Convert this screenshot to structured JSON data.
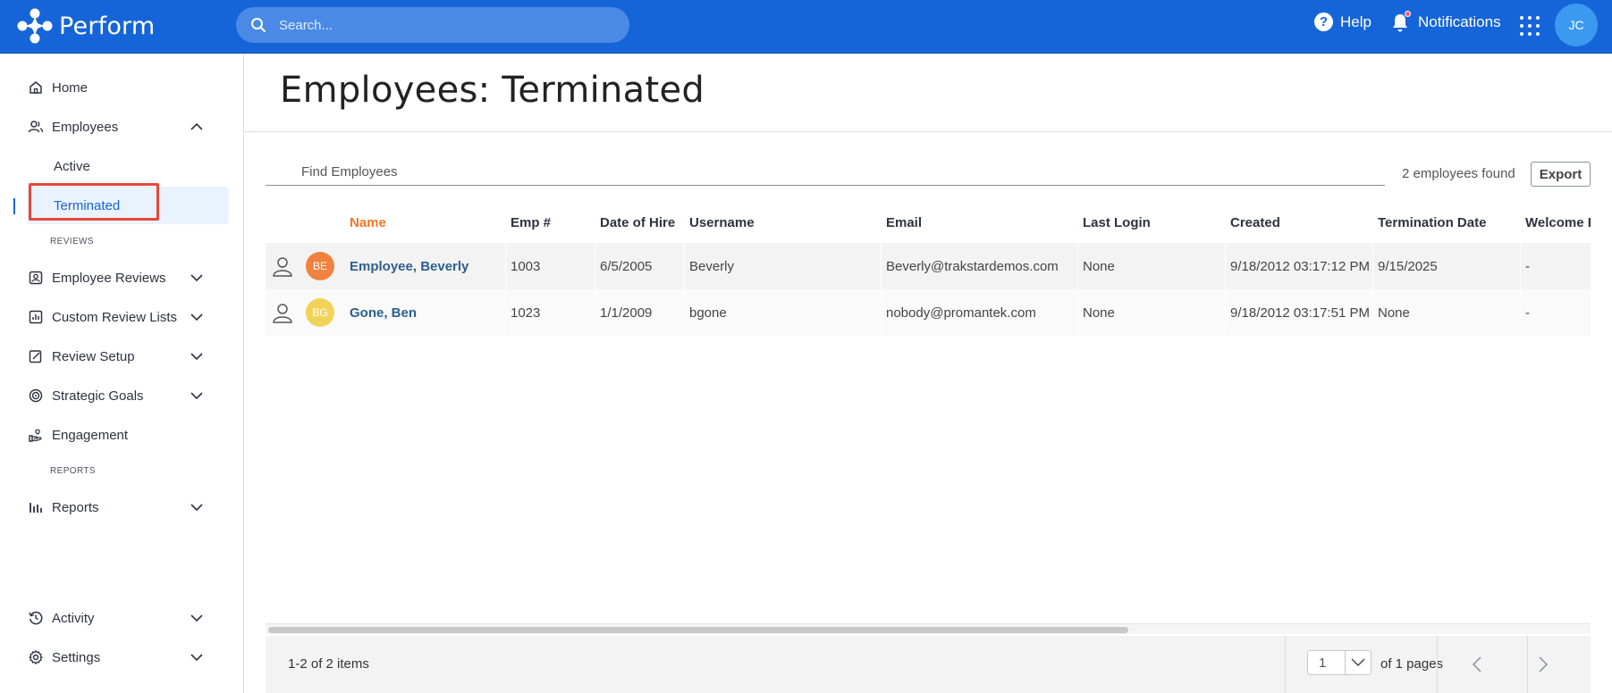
{
  "app": {
    "name": "Perform"
  },
  "topbar": {
    "search_placeholder": "Search...",
    "help_label": "Help",
    "notifications_label": "Notifications",
    "avatar_initials": "JC",
    "brand_color": "#1565d8"
  },
  "sidebar": {
    "home": "Home",
    "employees": "Employees",
    "employees_active": "Active",
    "employees_terminated": "Terminated",
    "section_reviews": "REVIEWS",
    "employee_reviews": "Employee Reviews",
    "custom_review_lists": "Custom Review Lists",
    "review_setup": "Review Setup",
    "strategic_goals": "Strategic Goals",
    "engagement": "Engagement",
    "section_reports": "REPORTS",
    "reports": "Reports",
    "activity": "Activity",
    "settings": "Settings"
  },
  "main": {
    "title": "Employees: Terminated",
    "find_placeholder": "Find Employees",
    "count_text": "2 employees found",
    "export_label": "Export"
  },
  "table": {
    "headers": {
      "name": "Name",
      "emp": "Emp #",
      "hire": "Date of Hire",
      "username": "Username",
      "email": "Email",
      "last_login": "Last Login",
      "created": "Created",
      "termination": "Termination Date",
      "welcome": "Welcome E"
    },
    "rows": [
      {
        "initials": "BE",
        "avatar_color": "#f0813f",
        "name": "Employee, Beverly",
        "emp": "1003",
        "hire": "6/5/2005",
        "username": "Beverly",
        "email": "Beverly@trakstardemos.com",
        "last_login": "None",
        "created": "9/18/2012 03:17:12 PM",
        "termination": "9/15/2025",
        "welcome": "-"
      },
      {
        "initials": "BG",
        "avatar_color": "#f2d35a",
        "name": "Gone, Ben",
        "emp": "1023",
        "hire": "1/1/2009",
        "username": "bgone",
        "email": "nobody@promantek.com",
        "last_login": "None",
        "created": "9/18/2012 03:17:51 PM",
        "termination": "None",
        "welcome": "-"
      }
    ]
  },
  "pager": {
    "items_text": "1-2 of 2 items",
    "page_value": "1",
    "of_pages": "of 1 pages"
  }
}
